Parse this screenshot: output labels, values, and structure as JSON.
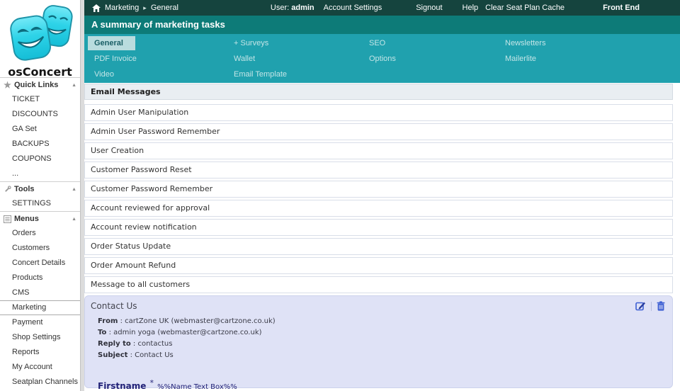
{
  "brand": "osConcert",
  "icons": {
    "collapse": "▲",
    "breadcrumb_separator": "▸",
    "star": "★"
  },
  "topbar": {
    "breadcrumb": [
      "Marketing",
      "General"
    ],
    "user_label": "User:",
    "user_name": "admin",
    "links": [
      "Account Settings",
      "Signout",
      "Help",
      "Clear Seat Plan Cache"
    ],
    "front_end": "Front End"
  },
  "summary": {
    "title": "A summary of marketing tasks"
  },
  "tabs": {
    "active": "General",
    "row1": [
      "General",
      "+ Surveys",
      "SEO",
      "Newsletters"
    ],
    "row2": [
      "PDF Invoice",
      "Wallet",
      "Options",
      "Mailerlite"
    ],
    "row3": [
      "Video",
      "Email Template"
    ]
  },
  "sidebar": {
    "sections": [
      {
        "title": "Quick Links",
        "icon": "star-icon",
        "items": [
          "TICKET",
          "DISCOUNTS",
          "GA Set",
          "BACKUPS",
          "COUPONS",
          "..."
        ]
      },
      {
        "title": "Tools",
        "icon": "wrench-icon",
        "items": [
          "SETTINGS"
        ]
      },
      {
        "title": "Menus",
        "icon": "menu-icon",
        "selected": "Marketing",
        "items": [
          "Orders",
          "Customers",
          "Concert Details",
          "Products",
          "CMS",
          "Marketing",
          "Payment",
          "Shop Settings",
          "Reports",
          "My Account",
          "Seatplan Channels"
        ]
      }
    ]
  },
  "content": {
    "header": "Email Messages",
    "rows": [
      "Admin User Manipulation",
      "Admin User Password Remember",
      "User Creation",
      "Customer Password Reset",
      "Customer Password Remember",
      "Account reviewed for approval",
      "Account review notification",
      "Order Status Update",
      "Order Amount Refund",
      "Message to all customers"
    ],
    "contact": {
      "title": "Contact Us",
      "colon": ":",
      "fields": [
        {
          "label": "From",
          "value": "cartZone UK (webmaster@cartzone.co.uk)"
        },
        {
          "label": "To",
          "value": "admin yoga (webmaster@cartzone.co.uk)"
        },
        {
          "label": "Reply to",
          "value": "contactus"
        },
        {
          "label": "Subject",
          "value": "Contact Us"
        }
      ],
      "form_field_label": "Firstname",
      "required_mark": "*",
      "form_field_value": "%%Name Text Box%%"
    }
  },
  "colors": {
    "topbar_bg": "#15443e",
    "summary_bg": "#0d7b78",
    "tabs_bg": "#20a1ae",
    "active_tab_bg": "#b9dcde",
    "panel_bg": "#dfe2f6",
    "icon_blue": "#3d5fd3",
    "logo_cyan": "#2ed3e8"
  }
}
